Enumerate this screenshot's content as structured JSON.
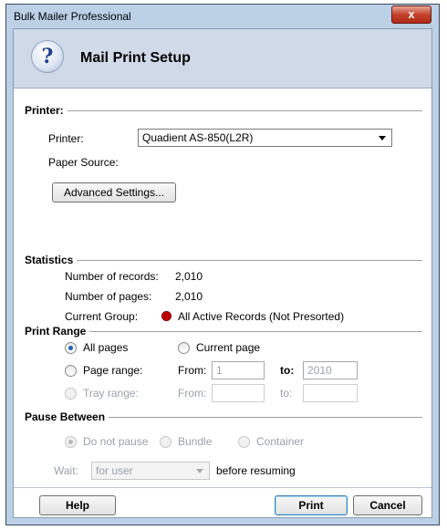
{
  "window": {
    "title": "Bulk Mailer Professional",
    "close_glyph": "x"
  },
  "header": {
    "icon": "help-question-icon",
    "title": "Mail Print Setup"
  },
  "printer_section": {
    "title": "Printer:",
    "printer_label": "Printer:",
    "printer_value": "Quadient AS-850(L2R)",
    "paper_source_label": "Paper Source:",
    "advanced_button": "Advanced Settings..."
  },
  "statistics": {
    "title": "Statistics",
    "records_label": "Number of records:",
    "records_value": "2,010",
    "pages_label": "Number of pages:",
    "pages_value": "2,010",
    "group_label": "Current Group:",
    "group_value": "All Active Records (Not Presorted)",
    "group_status_color": "#c00000"
  },
  "print_range": {
    "title": "Print Range",
    "all_pages": "All pages",
    "current_page": "Current page",
    "page_range": "Page range:",
    "tray_range": "Tray range:",
    "from_label": "From:",
    "to_label": "to:",
    "page_from": "1",
    "page_to": "2010",
    "tray_from": "",
    "tray_to": "",
    "selected": "All pages"
  },
  "pause_between": {
    "title": "Pause Between",
    "do_not_pause": "Do not pause",
    "bundle": "Bundle",
    "container": "Container",
    "wait_label": "Wait:",
    "wait_value": "for user",
    "before_resuming": "before resuming",
    "selected": "Do not pause"
  },
  "footer": {
    "help": "Help",
    "print": "Print",
    "cancel": "Cancel"
  },
  "colors": {
    "titlebar": "#bcd0e6",
    "header_band": "#cfd9e8",
    "close": "#c3412b",
    "radio_dot": "#1f63b6"
  }
}
